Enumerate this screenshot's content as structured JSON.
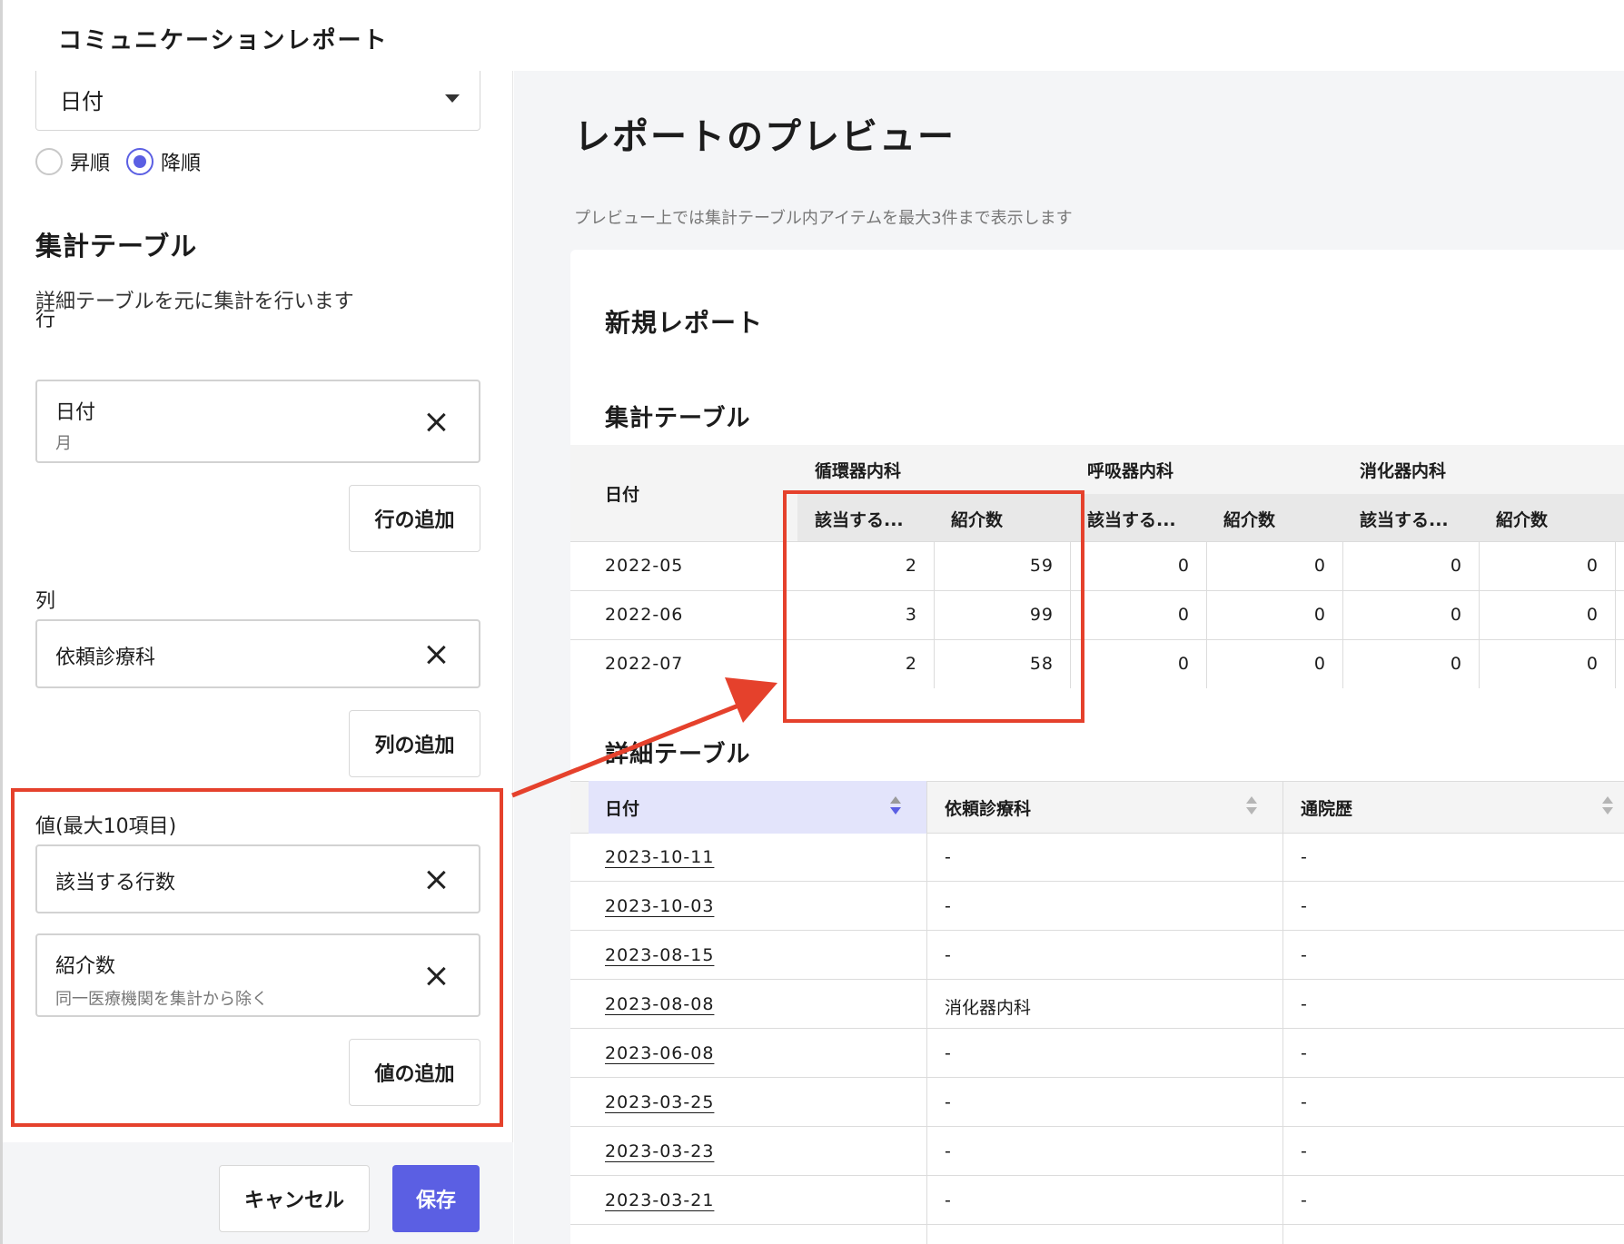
{
  "header": {
    "app_title": "コミュニケーションレポート"
  },
  "sort": {
    "field_value": "日付",
    "options": [
      {
        "label": "昇順",
        "checked": false
      },
      {
        "label": "降順",
        "checked": true
      }
    ]
  },
  "aggregate_settings": {
    "title": "集計テーブル",
    "description": "詳細テーブルを元に集計を行います",
    "rows_label": "行",
    "rows_item": {
      "main": "日付",
      "sub": "月"
    },
    "rows_add": "行の追加",
    "cols_label": "列",
    "cols_item": {
      "main": "依頼診療科"
    },
    "cols_add": "列の追加",
    "values_label": "値(最大10項目)",
    "values_items": [
      {
        "main": "該当する行数"
      },
      {
        "main": "紹介数",
        "sub": "同一医療機関を集計から除く"
      }
    ],
    "values_add": "値の追加"
  },
  "footer": {
    "cancel": "キャンセル",
    "save": "保存"
  },
  "preview": {
    "title": "レポートのプレビュー",
    "note": "プレビュー上では集計テーブル内アイテムを最大3件まで表示します",
    "report_name": "新規レポート",
    "aggregate": {
      "title": "集計テーブル",
      "row_header": "日付",
      "groups": [
        "循環器内科",
        "呼吸器内科",
        "消化器内科"
      ],
      "subheaders": [
        "該当する...",
        "紹介数",
        "該当する...",
        "紹介数",
        "該当する...",
        "紹介数"
      ],
      "rows": [
        {
          "date": "2022-05",
          "values": [
            "2",
            "59",
            "0",
            "0",
            "0",
            "0"
          ]
        },
        {
          "date": "2022-06",
          "values": [
            "3",
            "99",
            "0",
            "0",
            "0",
            "0"
          ]
        },
        {
          "date": "2022-07",
          "values": [
            "2",
            "58",
            "0",
            "0",
            "0",
            "0"
          ]
        }
      ]
    },
    "detail": {
      "title": "詳細テーブル",
      "columns": [
        "日付",
        "依頼診療科",
        "通院歴"
      ],
      "rows": [
        {
          "date": "2023-10-11",
          "dept": "-",
          "history": "-"
        },
        {
          "date": "2023-10-03",
          "dept": "-",
          "history": "-"
        },
        {
          "date": "2023-08-15",
          "dept": "-",
          "history": "-"
        },
        {
          "date": "2023-08-08",
          "dept": "消化器内科",
          "history": "-"
        },
        {
          "date": "2023-06-08",
          "dept": "-",
          "history": "-"
        },
        {
          "date": "2023-03-25",
          "dept": "-",
          "history": "-"
        },
        {
          "date": "2023-03-23",
          "dept": "-",
          "history": "-"
        },
        {
          "date": "2023-03-21",
          "dept": "-",
          "history": "-"
        }
      ]
    }
  },
  "colors": {
    "accent": "#5b5fe3",
    "highlight": "#e5412c",
    "panel_bg": "#f4f5f7"
  }
}
